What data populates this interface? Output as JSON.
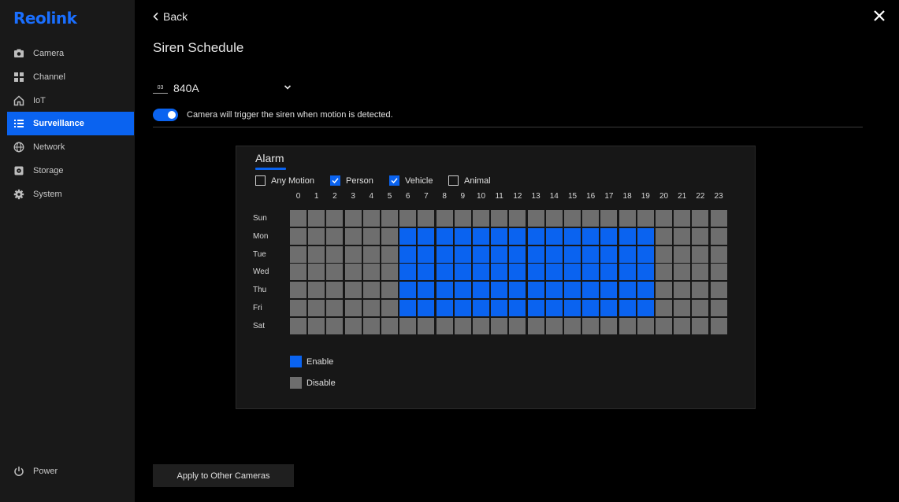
{
  "app": {
    "logo": "Reolink"
  },
  "sidebar": {
    "items": [
      {
        "label": "Camera",
        "icon": "camera-icon",
        "active": false
      },
      {
        "label": "Channel",
        "icon": "grid-icon",
        "active": false
      },
      {
        "label": "IoT",
        "icon": "home-icon",
        "active": false
      },
      {
        "label": "Surveillance",
        "icon": "list-icon",
        "active": true
      },
      {
        "label": "Network",
        "icon": "globe-icon",
        "active": false
      },
      {
        "label": "Storage",
        "icon": "storage-icon",
        "active": false
      },
      {
        "label": "System",
        "icon": "gear-icon",
        "active": false
      }
    ],
    "power_label": "Power"
  },
  "header": {
    "back_label": "Back",
    "title": "Siren Schedule"
  },
  "camera": {
    "badge": "03",
    "name": "840A"
  },
  "siren_toggle": {
    "on": true,
    "text": "Camera will trigger the siren when motion is detected."
  },
  "schedule": {
    "tab_label": "Alarm",
    "filters": [
      {
        "label": "Any Motion",
        "checked": false
      },
      {
        "label": "Person",
        "checked": true
      },
      {
        "label": "Vehicle",
        "checked": true
      },
      {
        "label": "Animal",
        "checked": false
      }
    ],
    "hours": [
      "0",
      "1",
      "2",
      "3",
      "4",
      "5",
      "6",
      "7",
      "8",
      "9",
      "10",
      "11",
      "12",
      "13",
      "14",
      "15",
      "16",
      "17",
      "18",
      "19",
      "20",
      "21",
      "22",
      "23"
    ],
    "days": [
      "Sun",
      "Mon",
      "Tue",
      "Wed",
      "Thu",
      "Fri",
      "Sat"
    ],
    "enabled": [
      [
        0,
        0,
        0,
        0,
        0,
        0,
        0,
        0,
        0,
        0,
        0,
        0,
        0,
        0,
        0,
        0,
        0,
        0,
        0,
        0,
        0,
        0,
        0,
        0
      ],
      [
        0,
        0,
        0,
        0,
        0,
        0,
        1,
        1,
        1,
        1,
        1,
        1,
        1,
        1,
        1,
        1,
        1,
        1,
        1,
        1,
        0,
        0,
        0,
        0
      ],
      [
        0,
        0,
        0,
        0,
        0,
        0,
        1,
        1,
        1,
        1,
        1,
        1,
        1,
        1,
        1,
        1,
        1,
        1,
        1,
        1,
        0,
        0,
        0,
        0
      ],
      [
        0,
        0,
        0,
        0,
        0,
        0,
        1,
        1,
        1,
        1,
        1,
        1,
        1,
        1,
        1,
        1,
        1,
        1,
        1,
        1,
        0,
        0,
        0,
        0
      ],
      [
        0,
        0,
        0,
        0,
        0,
        0,
        1,
        1,
        1,
        1,
        1,
        1,
        1,
        1,
        1,
        1,
        1,
        1,
        1,
        1,
        0,
        0,
        0,
        0
      ],
      [
        0,
        0,
        0,
        0,
        0,
        0,
        1,
        1,
        1,
        1,
        1,
        1,
        1,
        1,
        1,
        1,
        1,
        1,
        1,
        1,
        0,
        0,
        0,
        0
      ],
      [
        0,
        0,
        0,
        0,
        0,
        0,
        0,
        0,
        0,
        0,
        0,
        0,
        0,
        0,
        0,
        0,
        0,
        0,
        0,
        0,
        0,
        0,
        0,
        0
      ]
    ],
    "legend": [
      {
        "label": "Enable",
        "color": "#0a63f0"
      },
      {
        "label": "Disable",
        "color": "#6e6e6e"
      }
    ]
  },
  "footer": {
    "apply_label": "Apply to Other Cameras"
  }
}
